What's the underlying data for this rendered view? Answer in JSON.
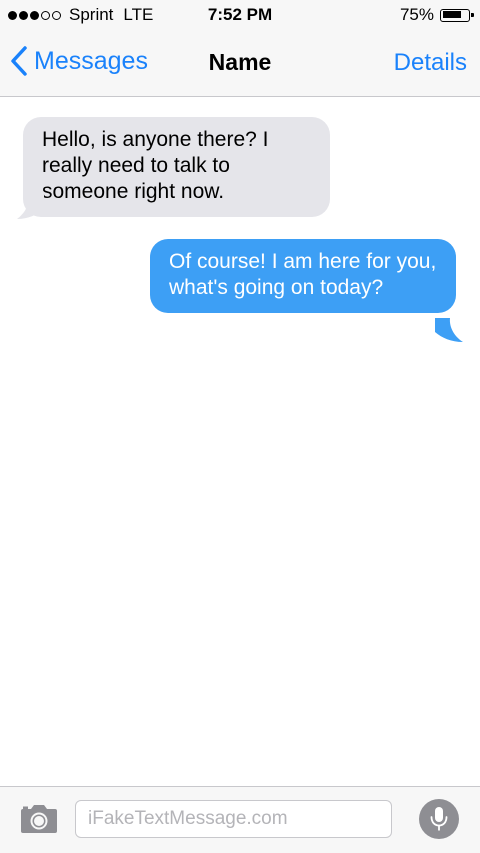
{
  "status_bar": {
    "signal_bars_filled": 3,
    "signal_bars_total": 5,
    "carrier": "Sprint",
    "network": "LTE",
    "time": "7:52 PM",
    "battery_percent_label": "75%",
    "battery_level": 0.75
  },
  "nav": {
    "back_label": "Messages",
    "title": "Name",
    "details_label": "Details"
  },
  "messages": [
    {
      "direction": "received",
      "text": "Hello, is anyone there? I really need to talk to someone right now."
    },
    {
      "direction": "sent",
      "text": "Of course! I am here for you, what's going on today?"
    }
  ],
  "input_bar": {
    "placeholder": "iFakeTextMessage.com",
    "value": "",
    "camera_icon": "camera-icon",
    "mic_icon": "microphone-icon"
  },
  "colors": {
    "accent": "#1a82fb",
    "sent_bubble": "#3d9ff5",
    "received_bubble": "#e5e5ea",
    "bar_background": "#f7f7f7"
  }
}
